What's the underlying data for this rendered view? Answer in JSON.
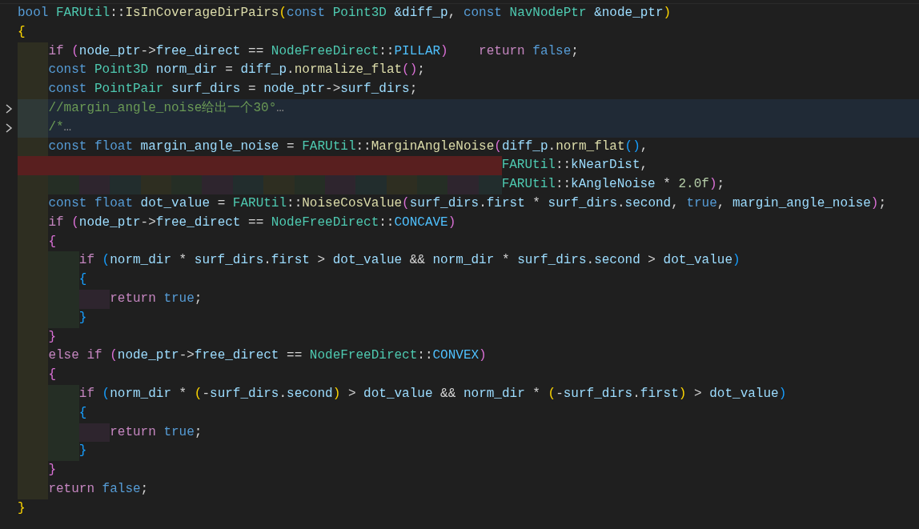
{
  "editor": {
    "lines": [
      {
        "folded": false,
        "error": false,
        "tokens": [
          {
            "text": "bool",
            "kind": "kw"
          },
          {
            "text": " FARUtil",
            "kind": "type"
          },
          {
            "text": "::",
            "kind": "txt"
          },
          {
            "text": "IsInCoverageDirPairs",
            "kind": "fn"
          },
          {
            "text": "(",
            "kind": "b1"
          },
          {
            "text": "const",
            "kind": "kw"
          },
          {
            "text": " Point3D",
            "kind": "type"
          },
          {
            "text": " &diff_p",
            "kind": "var"
          },
          {
            "text": ", ",
            "kind": "txt"
          },
          {
            "text": "const",
            "kind": "kw"
          },
          {
            "text": " NavNodePtr",
            "kind": "type"
          },
          {
            "text": " &node_ptr",
            "kind": "var"
          },
          {
            "text": ")",
            "kind": "b1"
          }
        ]
      },
      {
        "folded": false,
        "error": false,
        "tokens": [
          {
            "text": "{",
            "kind": "b1"
          }
        ]
      },
      {
        "folded": false,
        "error": false,
        "tokens": [
          {
            "text": "    if",
            "kind": "ctl"
          },
          {
            "text": " (",
            "kind": "b2"
          },
          {
            "text": "node_ptr",
            "kind": "var"
          },
          {
            "text": "->",
            "kind": "txt"
          },
          {
            "text": "free_direct",
            "kind": "var"
          },
          {
            "text": " == ",
            "kind": "txt"
          },
          {
            "text": "NodeFreeDirect",
            "kind": "type"
          },
          {
            "text": "::",
            "kind": "txt"
          },
          {
            "text": "PILLAR",
            "kind": "enum"
          },
          {
            "text": ")",
            "kind": "b2"
          },
          {
            "text": "    return",
            "kind": "ctl"
          },
          {
            "text": " false",
            "kind": "kw"
          },
          {
            "text": ";",
            "kind": "txt"
          }
        ]
      },
      {
        "folded": false,
        "error": false,
        "tokens": [
          {
            "text": "    const",
            "kind": "kw"
          },
          {
            "text": " Point3D",
            "kind": "type"
          },
          {
            "text": " norm_dir",
            "kind": "var"
          },
          {
            "text": " = ",
            "kind": "txt"
          },
          {
            "text": "diff_p",
            "kind": "var"
          },
          {
            "text": ".",
            "kind": "txt"
          },
          {
            "text": "normalize_flat",
            "kind": "fn"
          },
          {
            "text": "()",
            "kind": "b2"
          },
          {
            "text": ";",
            "kind": "txt"
          }
        ]
      },
      {
        "folded": false,
        "error": false,
        "tokens": [
          {
            "text": "    const",
            "kind": "kw"
          },
          {
            "text": " PointPair",
            "kind": "type"
          },
          {
            "text": " surf_dirs",
            "kind": "var"
          },
          {
            "text": " = ",
            "kind": "txt"
          },
          {
            "text": "node_ptr",
            "kind": "var"
          },
          {
            "text": "->",
            "kind": "txt"
          },
          {
            "text": "surf_dirs",
            "kind": "var"
          },
          {
            "text": ";",
            "kind": "txt"
          }
        ]
      },
      {
        "folded": true,
        "error": false,
        "tokens": [
          {
            "text": "    //margin_angle_noise给出一个30°",
            "kind": "cmt"
          },
          {
            "text": "…",
            "kind": "fold"
          }
        ]
      },
      {
        "folded": true,
        "error": false,
        "tokens": [
          {
            "text": "    /*",
            "kind": "cmt"
          },
          {
            "text": "…",
            "kind": "fold"
          }
        ]
      },
      {
        "folded": false,
        "error": false,
        "tokens": [
          {
            "text": "    const",
            "kind": "kw"
          },
          {
            "text": " float",
            "kind": "kw"
          },
          {
            "text": " margin_angle_noise",
            "kind": "var"
          },
          {
            "text": " = ",
            "kind": "txt"
          },
          {
            "text": "FARUtil",
            "kind": "type"
          },
          {
            "text": "::",
            "kind": "txt"
          },
          {
            "text": "MarginAngleNoise",
            "kind": "fn"
          },
          {
            "text": "(",
            "kind": "b2"
          },
          {
            "text": "diff_p",
            "kind": "var"
          },
          {
            "text": ".",
            "kind": "txt"
          },
          {
            "text": "norm_flat",
            "kind": "fn"
          },
          {
            "text": "()",
            "kind": "b3"
          },
          {
            "text": ",",
            "kind": "txt"
          }
        ]
      },
      {
        "folded": false,
        "error": true,
        "tokens": [
          {
            "text": "                                                               FARUtil",
            "kind": "type"
          },
          {
            "text": "::",
            "kind": "txt"
          },
          {
            "text": "kNearDist",
            "kind": "var"
          },
          {
            "text": ",",
            "kind": "txt"
          }
        ]
      },
      {
        "folded": false,
        "error": false,
        "tokens": [
          {
            "text": "                                                               FARUtil",
            "kind": "type"
          },
          {
            "text": "::",
            "kind": "txt"
          },
          {
            "text": "kAngleNoise",
            "kind": "var"
          },
          {
            "text": " * ",
            "kind": "txt"
          },
          {
            "text": "2.0f",
            "kind": "num"
          },
          {
            "text": ")",
            "kind": "b2"
          },
          {
            "text": ";",
            "kind": "txt"
          }
        ]
      },
      {
        "folded": false,
        "error": false,
        "tokens": [
          {
            "text": "    const",
            "kind": "kw"
          },
          {
            "text": " float",
            "kind": "kw"
          },
          {
            "text": " dot_value",
            "kind": "var"
          },
          {
            "text": " = ",
            "kind": "txt"
          },
          {
            "text": "FARUtil",
            "kind": "type"
          },
          {
            "text": "::",
            "kind": "txt"
          },
          {
            "text": "NoiseCosValue",
            "kind": "fn"
          },
          {
            "text": "(",
            "kind": "b2"
          },
          {
            "text": "surf_dirs",
            "kind": "var"
          },
          {
            "text": ".",
            "kind": "txt"
          },
          {
            "text": "first",
            "kind": "var"
          },
          {
            "text": " * ",
            "kind": "txt"
          },
          {
            "text": "surf_dirs",
            "kind": "var"
          },
          {
            "text": ".",
            "kind": "txt"
          },
          {
            "text": "second",
            "kind": "var"
          },
          {
            "text": ", ",
            "kind": "txt"
          },
          {
            "text": "true",
            "kind": "kw"
          },
          {
            "text": ", ",
            "kind": "txt"
          },
          {
            "text": "margin_angle_noise",
            "kind": "var"
          },
          {
            "text": ")",
            "kind": "b2"
          },
          {
            "text": ";",
            "kind": "txt"
          }
        ]
      },
      {
        "folded": false,
        "error": false,
        "tokens": [
          {
            "text": "    if",
            "kind": "ctl"
          },
          {
            "text": " (",
            "kind": "b2"
          },
          {
            "text": "node_ptr",
            "kind": "var"
          },
          {
            "text": "->",
            "kind": "txt"
          },
          {
            "text": "free_direct",
            "kind": "var"
          },
          {
            "text": " == ",
            "kind": "txt"
          },
          {
            "text": "NodeFreeDirect",
            "kind": "type"
          },
          {
            "text": "::",
            "kind": "txt"
          },
          {
            "text": "CONCAVE",
            "kind": "enum"
          },
          {
            "text": ")",
            "kind": "b2"
          }
        ]
      },
      {
        "folded": false,
        "error": false,
        "tokens": [
          {
            "text": "    {",
            "kind": "b2"
          }
        ]
      },
      {
        "folded": false,
        "error": false,
        "tokens": [
          {
            "text": "        if",
            "kind": "ctl"
          },
          {
            "text": " (",
            "kind": "b3"
          },
          {
            "text": "norm_dir",
            "kind": "var"
          },
          {
            "text": " * ",
            "kind": "txt"
          },
          {
            "text": "surf_dirs",
            "kind": "var"
          },
          {
            "text": ".",
            "kind": "txt"
          },
          {
            "text": "first",
            "kind": "var"
          },
          {
            "text": " > ",
            "kind": "txt"
          },
          {
            "text": "dot_value",
            "kind": "var"
          },
          {
            "text": " && ",
            "kind": "txt"
          },
          {
            "text": "norm_dir",
            "kind": "var"
          },
          {
            "text": " * ",
            "kind": "txt"
          },
          {
            "text": "surf_dirs",
            "kind": "var"
          },
          {
            "text": ".",
            "kind": "txt"
          },
          {
            "text": "second",
            "kind": "var"
          },
          {
            "text": " > ",
            "kind": "txt"
          },
          {
            "text": "dot_value",
            "kind": "var"
          },
          {
            "text": ")",
            "kind": "b3"
          }
        ]
      },
      {
        "folded": false,
        "error": false,
        "tokens": [
          {
            "text": "        {",
            "kind": "b3"
          }
        ]
      },
      {
        "folded": false,
        "error": false,
        "tokens": [
          {
            "text": "            return",
            "kind": "ctl"
          },
          {
            "text": " true",
            "kind": "kw"
          },
          {
            "text": ";",
            "kind": "txt"
          }
        ]
      },
      {
        "folded": false,
        "error": false,
        "tokens": [
          {
            "text": "        }",
            "kind": "b3"
          }
        ]
      },
      {
        "folded": false,
        "error": false,
        "tokens": [
          {
            "text": "    }",
            "kind": "b2"
          }
        ]
      },
      {
        "folded": false,
        "error": false,
        "tokens": [
          {
            "text": "    else",
            "kind": "ctl"
          },
          {
            "text": " if",
            "kind": "ctl"
          },
          {
            "text": " (",
            "kind": "b2"
          },
          {
            "text": "node_ptr",
            "kind": "var"
          },
          {
            "text": "->",
            "kind": "txt"
          },
          {
            "text": "free_direct",
            "kind": "var"
          },
          {
            "text": " == ",
            "kind": "txt"
          },
          {
            "text": "NodeFreeDirect",
            "kind": "type"
          },
          {
            "text": "::",
            "kind": "txt"
          },
          {
            "text": "CONVEX",
            "kind": "enum"
          },
          {
            "text": ")",
            "kind": "b2"
          }
        ]
      },
      {
        "folded": false,
        "error": false,
        "tokens": [
          {
            "text": "    {",
            "kind": "b2"
          }
        ]
      },
      {
        "folded": false,
        "error": false,
        "tokens": [
          {
            "text": "        if",
            "kind": "ctl"
          },
          {
            "text": " (",
            "kind": "b3"
          },
          {
            "text": "norm_dir",
            "kind": "var"
          },
          {
            "text": " * ",
            "kind": "txt"
          },
          {
            "text": "(",
            "kind": "b1"
          },
          {
            "text": "-",
            "kind": "txt"
          },
          {
            "text": "surf_dirs",
            "kind": "var"
          },
          {
            "text": ".",
            "kind": "txt"
          },
          {
            "text": "second",
            "kind": "var"
          },
          {
            "text": ")",
            "kind": "b1"
          },
          {
            "text": " > ",
            "kind": "txt"
          },
          {
            "text": "dot_value",
            "kind": "var"
          },
          {
            "text": " && ",
            "kind": "txt"
          },
          {
            "text": "norm_dir",
            "kind": "var"
          },
          {
            "text": " * ",
            "kind": "txt"
          },
          {
            "text": "(",
            "kind": "b1"
          },
          {
            "text": "-",
            "kind": "txt"
          },
          {
            "text": "surf_dirs",
            "kind": "var"
          },
          {
            "text": ".",
            "kind": "txt"
          },
          {
            "text": "first",
            "kind": "var"
          },
          {
            "text": ")",
            "kind": "b1"
          },
          {
            "text": " > ",
            "kind": "txt"
          },
          {
            "text": "dot_value",
            "kind": "var"
          },
          {
            "text": ")",
            "kind": "b3"
          }
        ]
      },
      {
        "folded": false,
        "error": false,
        "tokens": [
          {
            "text": "        {",
            "kind": "b3"
          }
        ]
      },
      {
        "folded": false,
        "error": false,
        "tokens": [
          {
            "text": "            return",
            "kind": "ctl"
          },
          {
            "text": " true",
            "kind": "kw"
          },
          {
            "text": ";",
            "kind": "txt"
          }
        ]
      },
      {
        "folded": false,
        "error": false,
        "tokens": [
          {
            "text": "        }",
            "kind": "b3"
          }
        ]
      },
      {
        "folded": false,
        "error": false,
        "tokens": [
          {
            "text": "    }",
            "kind": "b2"
          }
        ]
      },
      {
        "folded": false,
        "error": false,
        "tokens": [
          {
            "text": "    return",
            "kind": "ctl"
          },
          {
            "text": " false",
            "kind": "kw"
          },
          {
            "text": ";",
            "kind": "txt"
          }
        ]
      },
      {
        "folded": false,
        "error": false,
        "tokens": [
          {
            "text": "}",
            "kind": "b1"
          }
        ]
      }
    ]
  }
}
